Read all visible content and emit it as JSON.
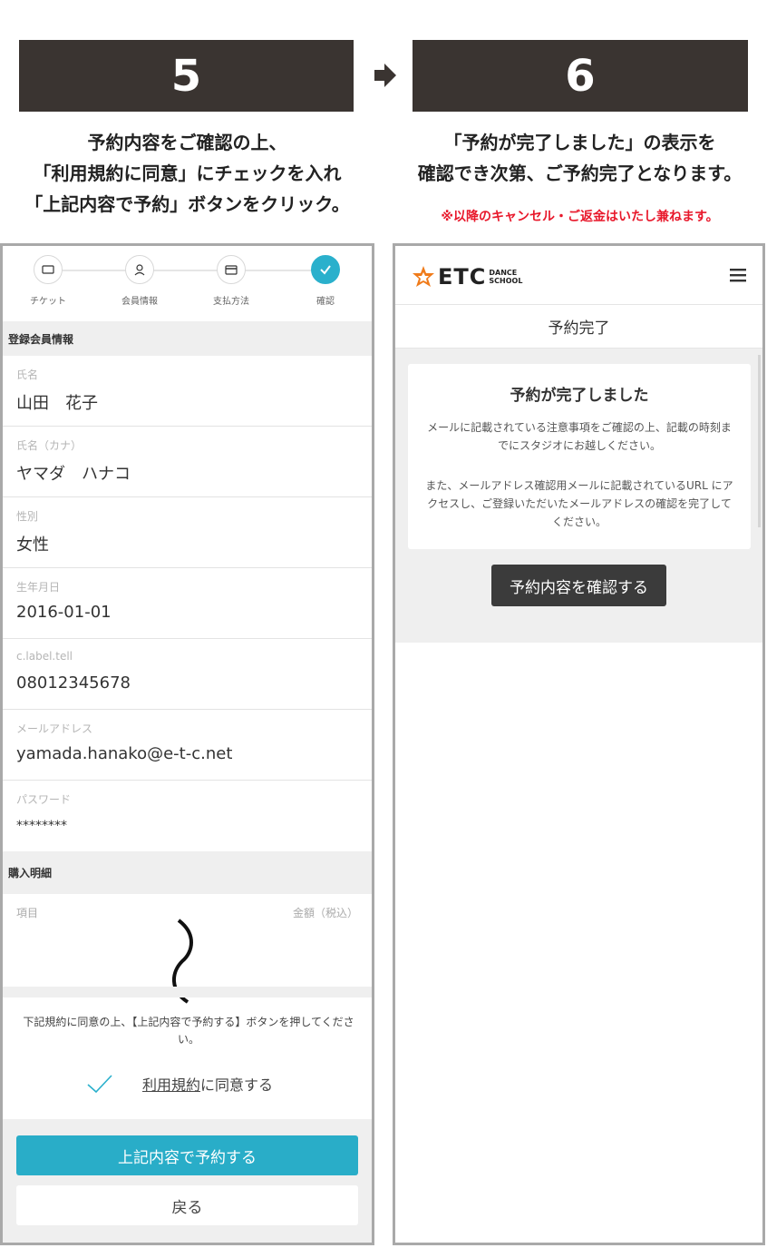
{
  "steps": {
    "left_number": "5",
    "right_number": "6"
  },
  "left_instructions": [
    "予約内容をご確認の上、",
    "「利用規約に同意」にチェックを入れ",
    "「上記内容で予約」ボタンをクリック。"
  ],
  "right_instructions": [
    "「予約が完了しました」の表示を",
    "確認でき次第、ご予約完了となります。"
  ],
  "warning": "※以降のキャンセル・ご返金はいたし兼ねます。",
  "colors": {
    "accent": "#2ab0cc",
    "banner": "#3a3431",
    "warning": "#e8182b"
  },
  "left_screen": {
    "stepper": [
      {
        "label": "チケット",
        "icon": "ticket-icon"
      },
      {
        "label": "会員情報",
        "icon": "user-icon"
      },
      {
        "label": "支払方法",
        "icon": "card-icon"
      },
      {
        "label": "確認",
        "icon": "check-icon"
      }
    ],
    "member_section_title": "登録会員情報",
    "fields": [
      {
        "label": "氏名",
        "value": "山田　花子"
      },
      {
        "label": "氏名（カナ）",
        "value": "ヤマダ　ハナコ"
      },
      {
        "label": "性別",
        "value": "女性"
      },
      {
        "label": "生年月日",
        "value": "2016-01-01"
      },
      {
        "label": "c.label.tell",
        "value": "08012345678"
      },
      {
        "label": "メールアドレス",
        "value": "yamada.hanako@e-t-c.net"
      },
      {
        "label": "パスワード",
        "value": "********"
      }
    ],
    "purchase_section_title": "購入明細",
    "purchase_item_header": "項目",
    "purchase_amount_header": "金額（税込）",
    "agree_instruction": "下記規約に同意の上、【上記内容で予約する】ボタンを押してください。",
    "terms_link": "利用規約",
    "agree_suffix": "に同意する",
    "submit_button": "上記内容で予約する",
    "back_button": "戻る"
  },
  "right_screen": {
    "logo_main": "ETC",
    "logo_sub1": "DANCE",
    "logo_sub2": "SCHOOL",
    "page_title": "予約完了",
    "card_title": "予約が完了しました",
    "message1": "メールに記載されている注意事項をご確認の上、記載の時刻までにスタジオにお越しください。",
    "message2": "また、メールアドレス確認用メールに記載されているURL にアクセスし、ご登録いただいたメールアドレスの確認を完了してください。",
    "confirm_button": "予約内容を確認する"
  }
}
